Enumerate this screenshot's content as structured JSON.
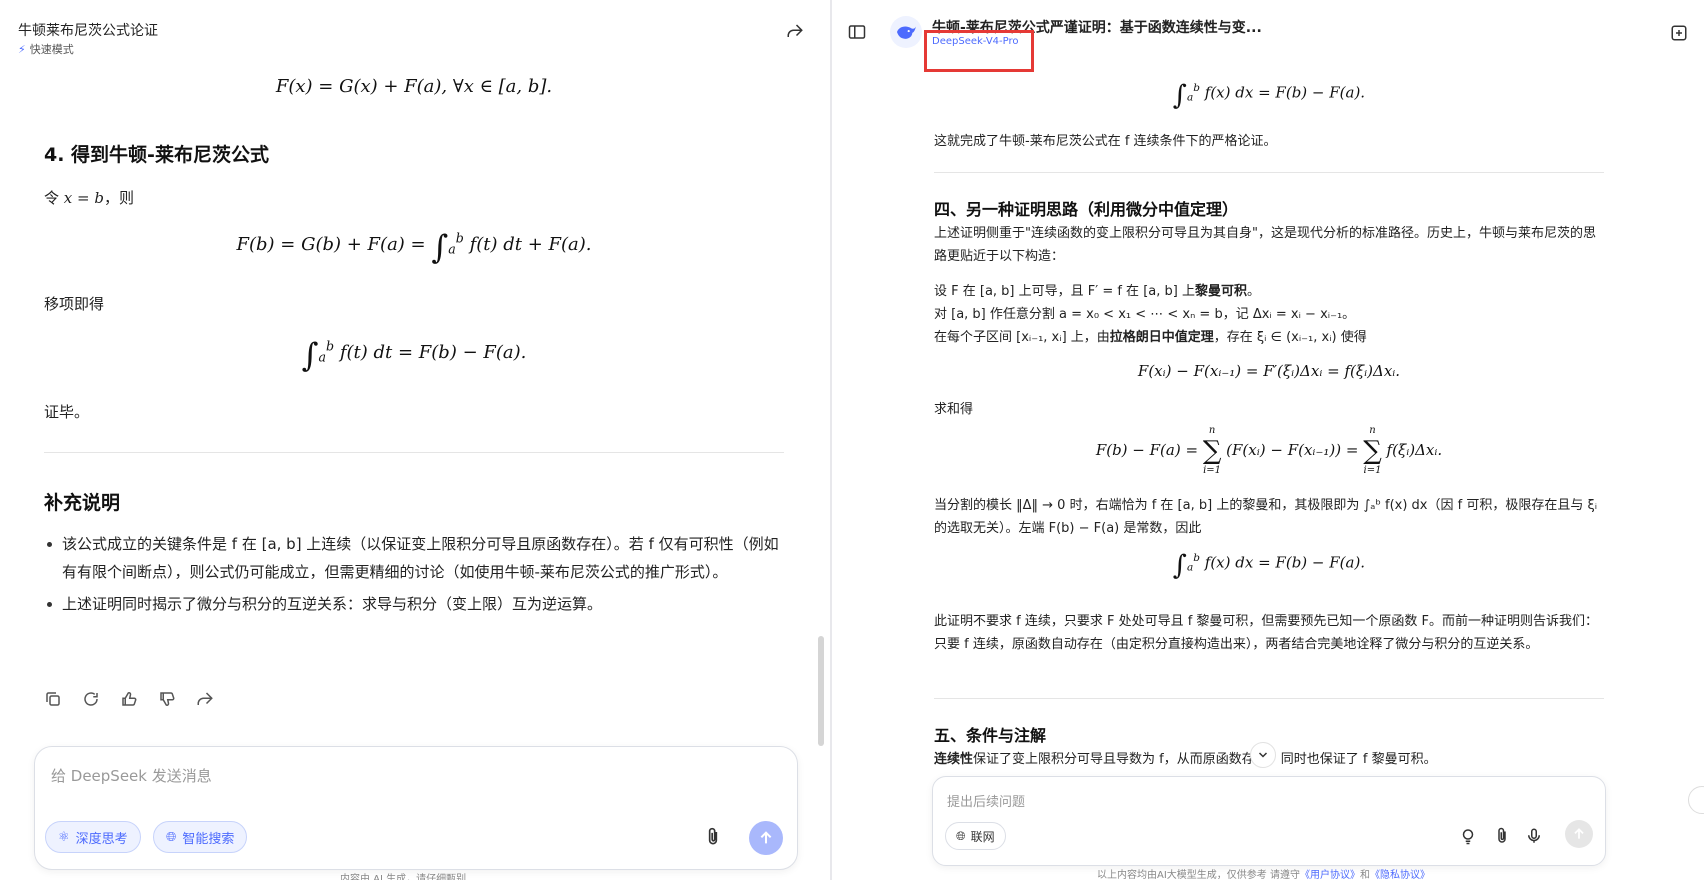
{
  "left": {
    "title": "牛顿莱布尼茨公式论证",
    "mode": "快速模式",
    "eq1": "F(x) = G(x) + F(a),    ∀x ∈ [a, b].",
    "h_step4": "4. 得到牛顿-莱布尼茨公式",
    "p_let_pre": "令",
    "p_let_math": "x = b",
    "p_let_post": "，则",
    "eq2_left": "F(b) = G(b) + F(a) =",
    "eq2_right": "f(t) dt + F(a).",
    "p_move": "移项即得",
    "eq3_right": "f(t) dt = F(b) − F(a).",
    "p_qed": "证毕。",
    "h_supp": "补充说明",
    "bullets": [
      "该公式成立的关键条件是 f 在 [a, b] 上连续（以保证变上限积分可导且原函数存在）。若 f 仅有可积性（例如有有限个间断点），则公式仍可能成立，但需更精细的讨论（如使用牛顿-莱布尼茨公式的推广形式）。",
      "上述证明同时揭示了微分与积分的互逆关系：求导与积分（变上限）互为逆运算。"
    ],
    "input_placeholder": "给 DeepSeek 发送消息",
    "chip_deep": "深度思考",
    "chip_search": "智能搜索",
    "footer": "内容由 AI 生成，请仔细甄别"
  },
  "right": {
    "title": "牛顿-莱布尼茨公式严谨证明：基于函数连续性与变...",
    "model": "DeepSeek-V4-Pro",
    "eq_top": "f(x) dx = F(b) − F(a).",
    "p_done": "这就完成了牛顿-莱布尼茨公式在 f 连续条件下的严格论证。",
    "h4": "四、另一种证明思路（利用微分中值定理）",
    "p_intro": "上述证明侧重于\"连续函数的变上限积分可导且为其自身\"，这是现代分析的标准路径。历史上，牛顿与莱布尼茨的思路更贴近于以下构造：",
    "p_set_1": "设 F 在 [a, b] 上可导，且 F′ = f 在 [a, b] 上",
    "p_set_1b": "黎曼可积",
    "p_set_2": "对 [a, b] 作任意分割 a = x₀ < x₁ < ⋯ < xₙ = b，记 Δxᵢ = xᵢ − xᵢ₋₁。",
    "p_set_3a": "在每个子区间 [xᵢ₋₁, xᵢ] 上，由",
    "p_set_3b": "拉格朗日中值定理",
    "p_set_3c": "，存在 ξᵢ ∈ (xᵢ₋₁, xᵢ) 使得",
    "eq_mvt": "F(xᵢ) − F(xᵢ₋₁) = F′(ξᵢ)Δxᵢ = f(ξᵢ)Δxᵢ.",
    "p_sum": "求和得",
    "eq_sum_l": "F(b) − F(a) =",
    "eq_sum_m": "(F(xᵢ) − F(xᵢ₋₁)) =",
    "eq_sum_r": "f(ξᵢ)Δxᵢ.",
    "p_lim": "当分割的模长 ‖Δ‖ → 0 时，右端恰为 f 在 [a, b] 上的黎曼和，其极限即为 ∫ₐᵇ f(x) dx（因 f 可积，极限存在且与 ξᵢ 的选取无关）。左端 F(b) − F(a) 是常数，因此",
    "eq_final": "f(x) dx = F(b) − F(a).",
    "p_note": "此证明不要求 f 连续，只要求 F 处处可导且 f 黎曼可积，但需要预先已知一个原函数 F。而前一种证明则告诉我们：只要 f 连续，原函数自动存在（由定积分直接构造出来），两者结合完美地诠释了微分与积分的互逆关系。",
    "h5": "五、条件与注解",
    "p_cond_b": "连续性",
    "p_cond": "保证了变上限积分可导且导数为 f，从而原函数存在；同时也保证了 f 黎曼可积。",
    "input_placeholder": "提出后续问题",
    "chip_web": "联网",
    "footer_pre": "以上内容均由AI大模型生成，仅供参考    请遵守",
    "footer_l1": "《用户协议》",
    "footer_mid": "和",
    "footer_l2": "《隐私协议》"
  },
  "colors": {
    "accent": "#4d6bfe",
    "highlight_box": "#e53935"
  }
}
